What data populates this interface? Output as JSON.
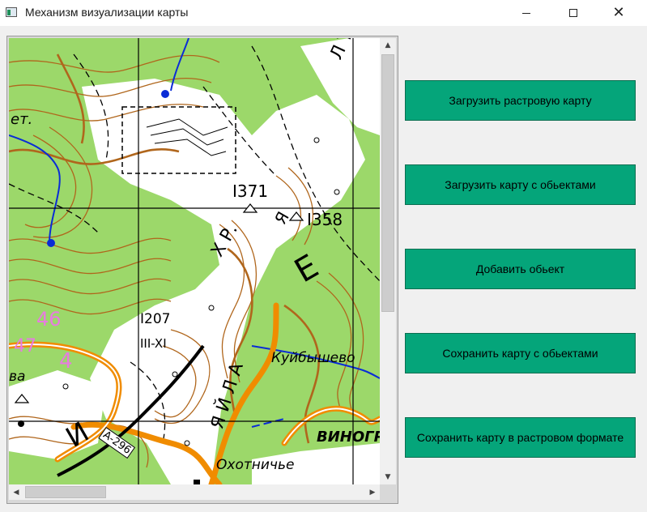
{
  "window": {
    "title": "Механизм визуализации карты",
    "controls": {
      "minimize": "—",
      "maximize": "☐",
      "close": "✕"
    }
  },
  "map": {
    "labels": {
      "spot_1371": "I371",
      "spot_1358": "I358",
      "spot_1207": "I207",
      "roman": "III-XI",
      "ridge_part1": "Х Р.",
      "ridge_part2": "Я Й Л А",
      "letter_e": "Е",
      "kuibyshevo": "Куйбышево",
      "okhotnichye": "Охотничье",
      "vinogr": "ВИНОГР",
      "road_code": "А-296",
      "road_letter": "И",
      "pink_46": "46",
      "pink_4": "4",
      "pink_47": "47",
      "partial_et": "ет.",
      "partial_va": "ва",
      "partial_ltin": "Л Т И Н",
      "partial_ya": "Я"
    },
    "colors": {
      "forest": "#9cd86a",
      "open_ground": "#ffffff",
      "contour": "#b0661c",
      "river": "#0a2cd6",
      "road": "#f08c00",
      "grid": "#000000",
      "pink_label": "#e77be0"
    }
  },
  "scrollbars": {
    "vertical": {
      "up_icon": "▲",
      "down_icon": "▼"
    },
    "horizontal": {
      "left_icon": "◀",
      "right_icon": "▶"
    }
  },
  "buttons": {
    "load_raster": "Загрузить растровую карту",
    "load_objects": "Загрузить карту с обьектами",
    "add_object": "Добавить обьект",
    "save_objects": "Сохранить карту с обьектами",
    "save_raster": "Сохранить карту в растровом формате"
  },
  "accent_color": "#05a57a"
}
